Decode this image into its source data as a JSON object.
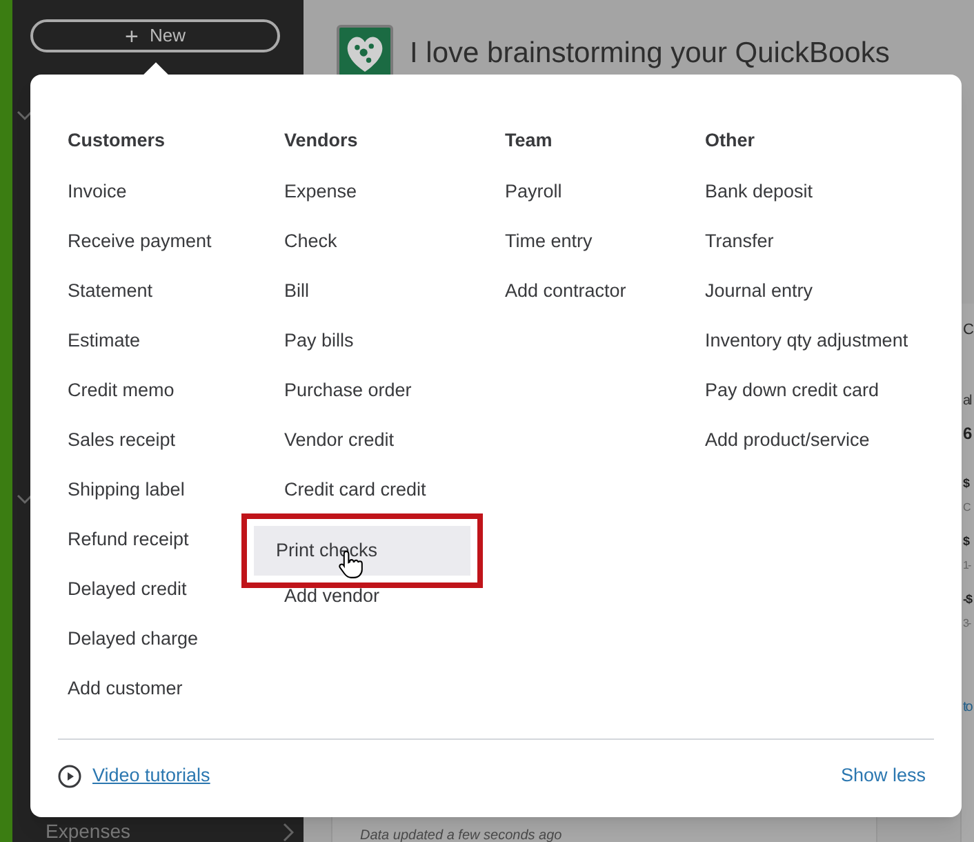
{
  "sidebar": {
    "new_button": {
      "icon": "+",
      "label": "New"
    },
    "items": [
      {
        "label": "Expenses"
      }
    ]
  },
  "header": {
    "title": "I love brainstorming your QuickBooks"
  },
  "background": {
    "card_note": "Data updated a few seconds ago",
    "right_fragments": [
      {
        "kind": "heading",
        "text": "C"
      },
      {
        "kind": "label",
        "text": "al"
      },
      {
        "kind": "big",
        "text": "6"
      },
      {
        "kind": "amount",
        "text": "$"
      },
      {
        "kind": "small",
        "text": "C"
      },
      {
        "kind": "amount",
        "text": "$"
      },
      {
        "kind": "small",
        "text": "1-"
      },
      {
        "kind": "amount",
        "text": "-$"
      },
      {
        "kind": "small",
        "text": "3-"
      },
      {
        "kind": "link",
        "text": "to"
      }
    ]
  },
  "menu": {
    "columns": [
      {
        "heading": "Customers",
        "items": [
          {
            "label": "Invoice",
            "selected": false
          },
          {
            "label": "Receive payment",
            "selected": false
          },
          {
            "label": "Statement",
            "selected": false
          },
          {
            "label": "Estimate",
            "selected": false
          },
          {
            "label": "Credit memo",
            "selected": false
          },
          {
            "label": "Sales receipt",
            "selected": false
          },
          {
            "label": "Shipping label",
            "selected": false
          },
          {
            "label": "Refund receipt",
            "selected": false
          },
          {
            "label": "Delayed credit",
            "selected": false
          },
          {
            "label": "Delayed charge",
            "selected": false
          },
          {
            "label": "Add customer",
            "selected": false
          }
        ]
      },
      {
        "heading": "Vendors",
        "items": [
          {
            "label": "Expense",
            "selected": false
          },
          {
            "label": "Check",
            "selected": false
          },
          {
            "label": "Bill",
            "selected": false
          },
          {
            "label": "Pay bills",
            "selected": false
          },
          {
            "label": "Purchase order",
            "selected": false
          },
          {
            "label": "Vendor credit",
            "selected": false
          },
          {
            "label": "Credit card credit",
            "selected": false
          },
          {
            "label": "Print checks",
            "selected": true
          },
          {
            "label": "Add vendor",
            "selected": false
          }
        ]
      },
      {
        "heading": "Team",
        "items": [
          {
            "label": "Payroll",
            "selected": false
          },
          {
            "label": "Time entry",
            "selected": false
          },
          {
            "label": "Add contractor",
            "selected": false
          }
        ]
      },
      {
        "heading": "Other",
        "items": [
          {
            "label": "Bank deposit",
            "selected": false
          },
          {
            "label": "Transfer",
            "selected": false
          },
          {
            "label": "Journal entry",
            "selected": false
          },
          {
            "label": "Inventory qty adjustment",
            "selected": false
          },
          {
            "label": "Pay down credit card",
            "selected": false
          },
          {
            "label": "Add product/service",
            "selected": false
          }
        ]
      }
    ],
    "footer": {
      "tutorials_link": "Video tutorials",
      "toggle": "Show less"
    }
  }
}
